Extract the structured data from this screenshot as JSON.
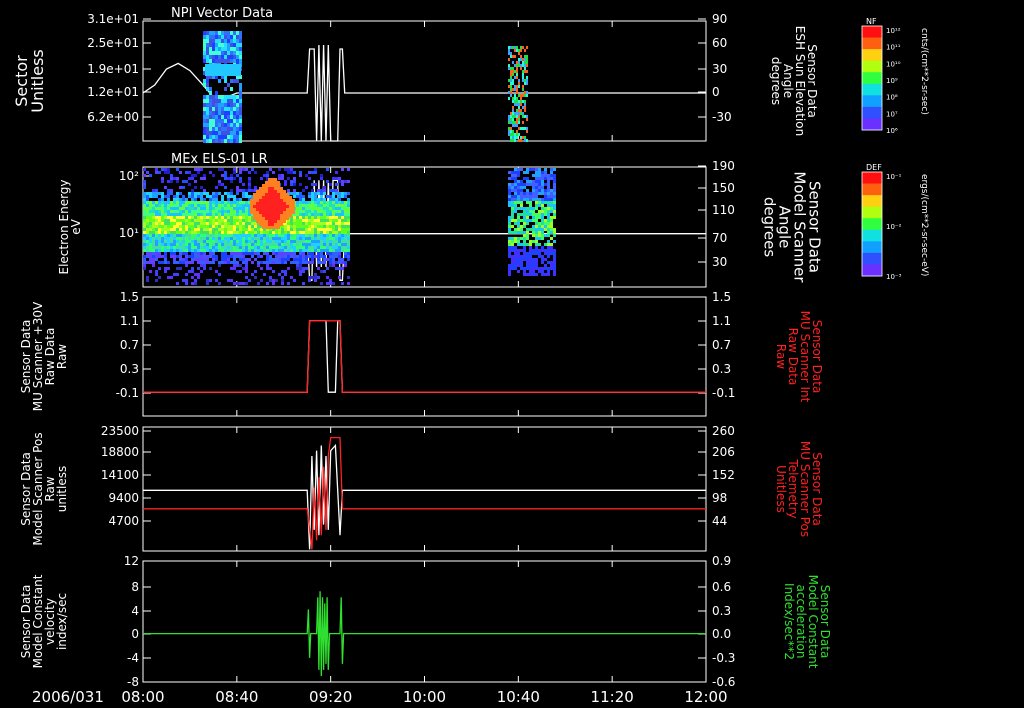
{
  "chart_data": [
    {
      "id": "p1",
      "type": "heatmap",
      "title": "NPI Vector Data",
      "ylabel_left": [
        "Sector",
        "Unitless"
      ],
      "yticks_left": [
        "3.1e+01",
        "2.5e+01",
        "1.9e+01",
        "1.2e+01",
        "6.2e+00"
      ],
      "ylabel_right": [
        "Sensor Data",
        "ESH Sun Elevation",
        "Angle",
        "degrees"
      ],
      "yticks_right": [
        "90",
        "60",
        "30",
        "0",
        "-30"
      ],
      "ylim_right": [
        -60,
        90
      ],
      "series": [
        {
          "color": "#ffffff",
          "x": [
            0,
            5,
            10,
            15,
            20,
            25,
            30,
            35,
            40,
            50,
            55,
            60,
            70,
            71,
            72,
            73,
            74,
            75,
            76,
            77,
            78,
            79,
            80,
            81,
            82,
            83,
            84,
            85,
            86,
            240
          ],
          "y": [
            0,
            10,
            30,
            37,
            28,
            12,
            -5,
            -6,
            0,
            0,
            0,
            0,
            0,
            55,
            55,
            55,
            -60,
            60,
            -60,
            60,
            -60,
            60,
            -60,
            -60,
            -60,
            -60,
            55,
            55,
            0,
            0
          ]
        }
      ],
      "colorbar": {
        "label": "NF",
        "units": "cnts/(cm**2-sr-sec)",
        "ticks": [
          "10¹²",
          "10¹¹",
          "10¹⁰",
          "10⁹",
          "10⁸",
          "10⁷",
          "10⁶"
        ]
      }
    },
    {
      "id": "p2",
      "type": "heatmap",
      "title": "MEx ELS-01 LR",
      "ylabel_left": [
        "Electron Energy",
        "eV"
      ],
      "yticks_left": [
        "10²",
        "10¹"
      ],
      "ylabel_right": [
        "Sensor Data",
        "Model Scanner",
        "Angle",
        "degrees"
      ],
      "yticks_right": [
        "190",
        "150",
        "110",
        "70",
        "30"
      ],
      "ylim_right": [
        10,
        190
      ],
      "series": [
        {
          "color": "#ffffff",
          "x": [
            0,
            20,
            40,
            60,
            70,
            71,
            72,
            73,
            74,
            75,
            76,
            77,
            78,
            79,
            80,
            81,
            82,
            83,
            84,
            85,
            86,
            240
          ],
          "y": [
            90,
            90,
            90,
            90,
            90,
            20,
            20,
            170,
            40,
            170,
            40,
            170,
            40,
            170,
            40,
            170,
            170,
            170,
            20,
            20,
            90,
            90
          ]
        }
      ],
      "colorbar": {
        "label": "DEF",
        "units": "ergs/(cm**2-sr-sec-eV)",
        "ticks": [
          "10⁻¹",
          "10⁻²",
          "10⁻³"
        ]
      }
    },
    {
      "id": "p3",
      "type": "line",
      "ylabel_left": [
        "Sensor Data",
        "MU Scanner +30V",
        "Raw Data",
        "Raw"
      ],
      "yticks_left": [
        "1.5",
        "1.1",
        "0.7",
        "0.3",
        "-0.1"
      ],
      "ylim": [
        -0.5,
        1.5
      ],
      "ylabel_right": [
        "Sensor Data",
        "MU Scanner Int",
        "Raw Data",
        "Raw"
      ],
      "yticks_right": [
        "1.5",
        "1.1",
        "0.7",
        "0.3",
        "-0.1"
      ],
      "series": [
        {
          "color": "#ffffff",
          "x": [
            0,
            70,
            71,
            78,
            79,
            82,
            83,
            84,
            85,
            240
          ],
          "y": [
            -0.1,
            -0.1,
            1.1,
            1.1,
            -0.1,
            -0.1,
            1.1,
            1.1,
            -0.1,
            -0.1
          ]
        },
        {
          "color": "#ff2020",
          "x": [
            0,
            70,
            71,
            84,
            85,
            240
          ],
          "y": [
            -0.1,
            -0.1,
            1.1,
            1.1,
            -0.1,
            -0.1
          ]
        }
      ]
    },
    {
      "id": "p4",
      "type": "line",
      "ylabel_left": [
        "Sensor Data",
        "Model Scanner Pos",
        "Raw",
        "unitless"
      ],
      "yticks_left": [
        "23500",
        "18800",
        "14100",
        "9400",
        "4700"
      ],
      "ylim": [
        0,
        23500
      ],
      "ylabel_right": [
        "Sensor Data",
        "MU Scanner Pos",
        "Telemetry",
        "Unitless"
      ],
      "yticks_right": [
        "260",
        "206",
        "152",
        "98",
        "44"
      ],
      "series": [
        {
          "color": "#ffffff",
          "x": [
            0,
            70,
            71,
            72,
            73,
            74,
            75,
            76,
            77,
            78,
            79,
            80,
            82,
            84,
            85,
            86,
            240
          ],
          "y": [
            11500,
            11500,
            300,
            18000,
            4000,
            19000,
            3000,
            20000,
            5000,
            18000,
            4000,
            19000,
            20000,
            3000,
            11500,
            11500,
            11500
          ]
        },
        {
          "color": "#ff2020",
          "x": [
            0,
            70,
            72,
            73,
            74,
            75,
            76,
            77,
            78,
            79,
            80,
            84,
            85,
            240
          ],
          "y": [
            8000,
            8000,
            300,
            12000,
            2000,
            14000,
            3000,
            16000,
            4000,
            18000,
            21500,
            21500,
            8000,
            8000
          ]
        }
      ]
    },
    {
      "id": "p5",
      "type": "line",
      "ylabel_left": [
        "Sensor Data",
        "Model Constant",
        "velocity",
        "index/sec"
      ],
      "yticks_left": [
        "12",
        "8",
        "4",
        "0",
        "-4",
        "-8"
      ],
      "ylim": [
        -8,
        12
      ],
      "ylabel_right": [
        "Sensor Data",
        "Model Constant",
        "acceleration",
        "Index/sec**2"
      ],
      "yticks_right": [
        "0.9",
        "0.6",
        "0.3",
        "0.0",
        "-0.3",
        "-0.6"
      ],
      "series": [
        {
          "color": "#30e030",
          "x": [
            0,
            70,
            70.5,
            71,
            71.5,
            72,
            74,
            74.5,
            75,
            75.5,
            76,
            76.5,
            77,
            77.5,
            78,
            78.5,
            79,
            79.5,
            80,
            84,
            84.5,
            85,
            85.5,
            86,
            240
          ],
          "y": [
            0,
            0,
            4,
            -4,
            0,
            0,
            0,
            6,
            -6,
            7,
            -7,
            6,
            -6,
            5,
            -5,
            6,
            -6,
            0,
            0,
            0,
            6,
            -5,
            0,
            0,
            0
          ]
        }
      ]
    }
  ],
  "x_axis": {
    "xlim_minutes": [
      0,
      240
    ],
    "date_label": "2006/031",
    "ticks": [
      {
        "m": 0,
        "label": "08:00"
      },
      {
        "m": 40,
        "label": "08:40"
      },
      {
        "m": 80,
        "label": "09:20"
      },
      {
        "m": 120,
        "label": "10:00"
      },
      {
        "m": 160,
        "label": "10:40"
      },
      {
        "m": 200,
        "label": "11:20"
      },
      {
        "m": 240,
        "label": "12:00"
      }
    ]
  },
  "colors": {
    "background": "#000000",
    "axes": "#ffffff",
    "red": "#ff2020",
    "green": "#30e030"
  }
}
